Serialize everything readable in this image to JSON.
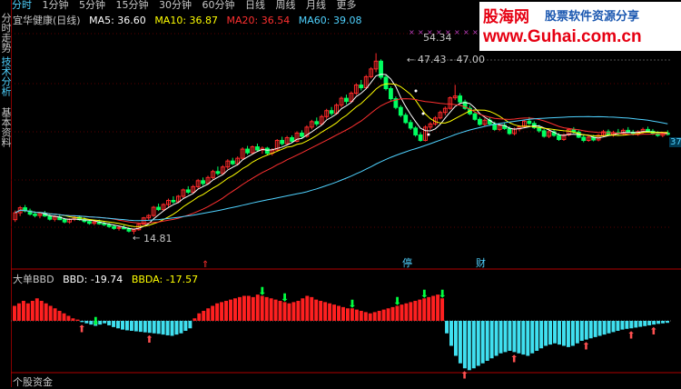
{
  "sidebar": {
    "tabs": [
      "分时走势",
      "技术分析",
      "基本资料"
    ]
  },
  "topbar": {
    "items": [
      "分时",
      "1分钟",
      "5分钟",
      "15分钟",
      "30分钟",
      "60分钟",
      "日线",
      "周线",
      "月线",
      "更多"
    ]
  },
  "legend": {
    "name": "宜华健康(日线)",
    "ma5": "MA5: 36.60",
    "ma10": "MA10: 36.87",
    "ma20": "MA20: 36.54",
    "ma60": "MA60: 39.08"
  },
  "indicator": {
    "name": "大单BBD",
    "bbd": "BBD: -19.74",
    "bbda": "BBDA: -17.57"
  },
  "bottom_label": "个股资金",
  "watermark": {
    "cn": "股海网",
    "slogan": "股票软件资源分享",
    "url": "www.Guhai.com.cn"
  },
  "price_badge": "37",
  "markers": {
    "stop": "停",
    "finance": "财"
  },
  "colors": {
    "up": "#ff2a2a",
    "down": "#00ff60",
    "ma5": "#ffffff",
    "ma10": "#ffff00",
    "ma20": "#ff3030",
    "ma60": "#4fd2ff",
    "bbd_pos": "#ff2020",
    "bbd_neg": "#40e0f0"
  },
  "chart_data": [
    {
      "type": "candlestick",
      "annotations": [
        {
          "text": "14.81",
          "value": 14.81
        },
        {
          "text": "54.34",
          "value": 54.34
        },
        {
          "text": "47.43 - 47.00",
          "value": 47.43
        }
      ],
      "ylim": [
        10,
        60
      ],
      "candles": [
        [
          18,
          20,
          17.5,
          19.5
        ],
        [
          19.5,
          21,
          18.8,
          20.6
        ],
        [
          20.6,
          21.2,
          19.6,
          19.9
        ],
        [
          19.9,
          20.4,
          18.9,
          19.2
        ],
        [
          19.2,
          19.8,
          18.5,
          18.9
        ],
        [
          18.9,
          19.6,
          18.3,
          19.3
        ],
        [
          19.3,
          19.9,
          18.6,
          18.8
        ],
        [
          18.8,
          19.2,
          17.8,
          18.1
        ],
        [
          18.1,
          18.9,
          17.6,
          18.6
        ],
        [
          18.6,
          19.1,
          17.9,
          18.0
        ],
        [
          18.0,
          18.4,
          17.2,
          17.5
        ],
        [
          17.5,
          18.3,
          17.1,
          18.1
        ],
        [
          18.1,
          18.8,
          17.7,
          18.5
        ],
        [
          18.5,
          18.9,
          17.8,
          18.0
        ],
        [
          18.0,
          18.5,
          17.3,
          17.6
        ],
        [
          17.6,
          18.1,
          16.9,
          17.2
        ],
        [
          17.2,
          17.8,
          16.8,
          17.5
        ],
        [
          17.5,
          18.0,
          16.9,
          17.1
        ],
        [
          17.1,
          17.6,
          16.6,
          16.9
        ],
        [
          16.9,
          17.3,
          16.2,
          16.5
        ],
        [
          16.5,
          16.9,
          15.8,
          16.1
        ],
        [
          16.1,
          16.6,
          15.6,
          16.3
        ],
        [
          16.3,
          16.8,
          15.9,
          16.0
        ],
        [
          16.0,
          16.4,
          15.2,
          15.5
        ],
        [
          15.5,
          16.0,
          14.81,
          15.8
        ],
        [
          15.8,
          17.2,
          15.6,
          17.0
        ],
        [
          17.0,
          18.6,
          16.8,
          18.4
        ],
        [
          18.4,
          19.2,
          17.9,
          18.9
        ],
        [
          18.9,
          21.0,
          18.6,
          20.7
        ],
        [
          20.7,
          21.5,
          19.9,
          20.2
        ],
        [
          20.2,
          21.6,
          19.8,
          21.3
        ],
        [
          21.3,
          22.6,
          20.8,
          22.2
        ],
        [
          22.2,
          23.1,
          21.5,
          21.9
        ],
        [
          21.9,
          23.4,
          21.6,
          23.1
        ],
        [
          23.1,
          24.8,
          22.7,
          24.5
        ],
        [
          24.5,
          25.3,
          23.6,
          24.0
        ],
        [
          24.0,
          25.6,
          23.7,
          25.2
        ],
        [
          25.2,
          26.9,
          24.8,
          26.5
        ],
        [
          26.5,
          27.2,
          25.4,
          25.9
        ],
        [
          25.9,
          27.6,
          25.6,
          27.2
        ],
        [
          27.2,
          28.9,
          26.8,
          28.5
        ],
        [
          28.5,
          29.6,
          27.7,
          28.1
        ],
        [
          28.1,
          29.9,
          27.8,
          29.5
        ],
        [
          29.5,
          31.2,
          29.0,
          30.8
        ],
        [
          30.8,
          31.5,
          29.9,
          30.2
        ],
        [
          30.2,
          31.8,
          29.8,
          31.4
        ],
        [
          31.4,
          33.8,
          31.0,
          33.4
        ],
        [
          33.4,
          34.1,
          32.2,
          32.6
        ],
        [
          32.6,
          34.2,
          32.2,
          33.9
        ],
        [
          33.9,
          34.6,
          32.8,
          33.2
        ],
        [
          33.2,
          34.0,
          32.4,
          33.6
        ],
        [
          33.6,
          33.9,
          32.1,
          32.5
        ],
        [
          32.5,
          33.6,
          32.0,
          33.2
        ],
        [
          33.2,
          35.6,
          33.0,
          35.3
        ],
        [
          35.3,
          36.1,
          34.2,
          34.6
        ],
        [
          34.6,
          36.3,
          34.3,
          35.9
        ],
        [
          35.9,
          36.4,
          34.8,
          35.1
        ],
        [
          35.1,
          37.3,
          34.9,
          36.9
        ],
        [
          36.9,
          37.5,
          35.8,
          36.2
        ],
        [
          36.2,
          38.6,
          35.9,
          38.2
        ],
        [
          38.2,
          39.8,
          37.7,
          39.4
        ],
        [
          39.4,
          40.3,
          38.4,
          38.9
        ],
        [
          38.9,
          40.9,
          38.6,
          40.5
        ],
        [
          40.5,
          42.2,
          40.0,
          41.8
        ],
        [
          41.8,
          42.6,
          40.7,
          41.2
        ],
        [
          41.2,
          43.4,
          40.9,
          43.0
        ],
        [
          43.0,
          44.9,
          42.5,
          44.5
        ],
        [
          44.5,
          45.3,
          43.2,
          43.8
        ],
        [
          43.8,
          46.0,
          43.5,
          45.6
        ],
        [
          45.6,
          47.8,
          45.2,
          47.4
        ],
        [
          47.4,
          48.5,
          46.2,
          46.8
        ],
        [
          46.8,
          49.6,
          46.5,
          49.2
        ],
        [
          49.2,
          51.3,
          48.8,
          50.9
        ],
        [
          50.9,
          54.34,
          50.2,
          52.6
        ],
        [
          52.6,
          53.0,
          48.6,
          49.1
        ],
        [
          49.1,
          49.6,
          46.2,
          46.6
        ],
        [
          46.6,
          47.1,
          44.0,
          44.4
        ],
        [
          44.4,
          44.9,
          42.1,
          42.5
        ],
        [
          42.5,
          43.0,
          40.4,
          40.8
        ],
        [
          40.8,
          41.3,
          38.9,
          39.2
        ],
        [
          39.2,
          39.8,
          37.6,
          38.0
        ],
        [
          38.0,
          38.4,
          36.1,
          36.5
        ],
        [
          36.5,
          37.1,
          35.0,
          35.3
        ],
        [
          35.3,
          38.6,
          35.1,
          38.2
        ],
        [
          38.2,
          39.3,
          37.6,
          38.9
        ],
        [
          38.9,
          40.6,
          38.5,
          40.2
        ],
        [
          40.2,
          41.8,
          39.9,
          41.4
        ],
        [
          41.4,
          42.7,
          40.8,
          42.3
        ],
        [
          42.3,
          44.9,
          42.0,
          44.6
        ],
        [
          44.6,
          47.43,
          44.1,
          45.0
        ],
        [
          45.0,
          45.6,
          43.3,
          43.7
        ],
        [
          43.7,
          44.2,
          42.0,
          42.3
        ],
        [
          42.3,
          42.9,
          40.8,
          41.1
        ],
        [
          41.1,
          41.6,
          39.6,
          39.9
        ],
        [
          39.9,
          40.4,
          38.5,
          38.8
        ],
        [
          38.8,
          40.1,
          38.4,
          39.7
        ],
        [
          39.7,
          40.3,
          38.6,
          38.9
        ],
        [
          38.9,
          39.4,
          37.4,
          37.7
        ],
        [
          37.7,
          38.9,
          37.3,
          38.6
        ],
        [
          38.6,
          39.1,
          37.6,
          37.9
        ],
        [
          37.9,
          38.4,
          36.5,
          36.8
        ],
        [
          36.8,
          38.1,
          36.4,
          37.8
        ],
        [
          37.8,
          38.6,
          37.3,
          38.3
        ],
        [
          38.3,
          39.8,
          38.0,
          39.5
        ],
        [
          39.5,
          40.4,
          38.7,
          39.0
        ],
        [
          39.0,
          39.5,
          37.8,
          38.1
        ],
        [
          38.1,
          38.7,
          37.0,
          37.4
        ],
        [
          37.4,
          37.8,
          35.9,
          36.2
        ],
        [
          36.2,
          37.5,
          35.8,
          37.2
        ],
        [
          37.2,
          37.6,
          36.1,
          36.4
        ],
        [
          36.4,
          36.9,
          35.2,
          35.5
        ],
        [
          35.5,
          36.8,
          35.2,
          36.5
        ],
        [
          36.5,
          38.0,
          36.2,
          37.7
        ],
        [
          37.7,
          38.2,
          36.8,
          37.1
        ],
        [
          37.1,
          37.5,
          35.8,
          36.0
        ],
        [
          36.0,
          36.6,
          34.9,
          35.3
        ],
        [
          35.3,
          36.3,
          35.0,
          36.0
        ],
        [
          36.0,
          36.5,
          35.1,
          35.4
        ],
        [
          35.4,
          36.7,
          35.1,
          36.4
        ],
        [
          36.4,
          37.6,
          36.1,
          37.2
        ],
        [
          37.2,
          37.7,
          36.3,
          36.6
        ],
        [
          36.6,
          37.4,
          36.1,
          37.0
        ],
        [
          37.0,
          37.8,
          36.5,
          36.8
        ],
        [
          36.8,
          37.9,
          36.5,
          37.5
        ],
        [
          37.5,
          38.2,
          36.9,
          37.1
        ],
        [
          37.1,
          37.6,
          36.4,
          36.7
        ],
        [
          36.7,
          37.5,
          36.3,
          37.2
        ],
        [
          37.2,
          38.1,
          36.8,
          37.7
        ],
        [
          37.7,
          38.3,
          37.0,
          37.3
        ],
        [
          37.3,
          37.8,
          36.5,
          36.8
        ],
        [
          36.8,
          37.3,
          36.1,
          36.4
        ],
        [
          36.4,
          37.2,
          36.0,
          36.9
        ],
        [
          36.9,
          37.5,
          36.4,
          36.6
        ]
      ],
      "series": [
        {
          "name": "MA5",
          "value": 36.6
        },
        {
          "name": "MA10",
          "value": 36.87
        },
        {
          "name": "MA20",
          "value": 36.54
        },
        {
          "name": "MA60",
          "value": 39.08
        }
      ]
    },
    {
      "type": "bar",
      "title": "大单BBD",
      "ylim": [
        -20,
        12
      ],
      "values": [
        6,
        7,
        8,
        7,
        8,
        9,
        8,
        7,
        6,
        5,
        4,
        3,
        2,
        1,
        0.5,
        -0.5,
        -1,
        -1.5,
        -2,
        -1.5,
        -1,
        -1.8,
        -2.5,
        -3,
        -3.5,
        -3.8,
        -4,
        -4.2,
        -4.4,
        -4.6,
        -4.8,
        -5,
        -5.2,
        -5.5,
        -5.8,
        -6,
        -5.5,
        -5,
        -4,
        -3,
        1,
        3,
        4,
        5,
        6,
        7,
        7.5,
        8,
        8.5,
        9,
        9.5,
        10,
        10,
        9.5,
        10.5,
        10,
        9.5,
        9,
        8.5,
        8,
        7.5,
        7,
        7.5,
        8,
        9,
        10,
        9.5,
        8.5,
        8,
        7.5,
        7,
        6.5,
        6,
        5.5,
        5,
        5,
        4.5,
        4,
        3.5,
        3,
        3.5,
        4,
        4.5,
        5,
        5.5,
        6,
        6.5,
        7,
        7.5,
        8,
        8.5,
        9,
        9.5,
        10,
        10.5,
        9,
        -5,
        -10,
        -14,
        -17,
        -19,
        -19.74,
        -19,
        -18,
        -17,
        -16,
        -15,
        -14,
        -13,
        -12.5,
        -12,
        -12.5,
        -13,
        -13.5,
        -14,
        -13,
        -12,
        -11,
        -10,
        -9.5,
        -9,
        -9.5,
        -10,
        -10.5,
        -10,
        -9,
        -8,
        -7.5,
        -7,
        -6.5,
        -6,
        -5.5,
        -5,
        -4.5,
        -4,
        -3.5,
        -3.2,
        -3,
        -2.7,
        -2.4,
        -2.1,
        -1.8,
        -1.5,
        -1.2,
        -1,
        -0.8
      ],
      "down_arrows": [
        18,
        55,
        60,
        75,
        85,
        91,
        95
      ],
      "up_arrows": [
        15,
        30,
        100,
        111,
        127,
        137,
        142
      ]
    }
  ]
}
